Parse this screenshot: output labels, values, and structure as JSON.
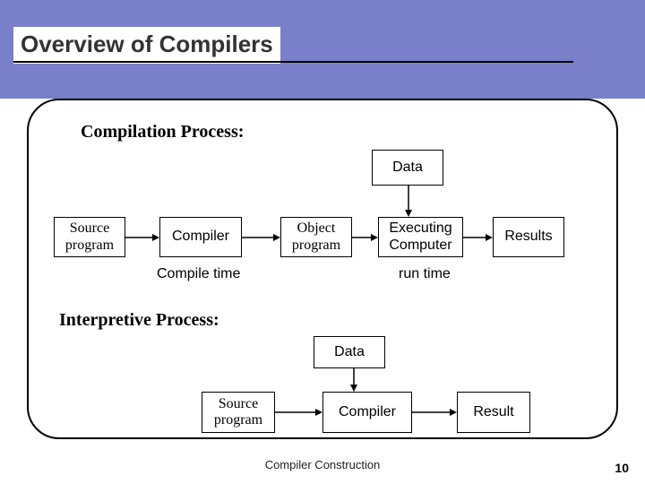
{
  "slide": {
    "title": "Overview of Compilers"
  },
  "section1": {
    "title": "Compilation Process:",
    "data_box": "Data",
    "source": "Source\nprogram",
    "compiler": "Compiler",
    "object": "Object\nprogram",
    "executing": "Executing\nComputer",
    "results": "Results",
    "compile_time": "Compile time",
    "run_time": "run time"
  },
  "section2": {
    "title": "Interpretive Process:",
    "data_box": "Data",
    "source": "Source\nprogram",
    "compiler": "Compiler",
    "result": "Result"
  },
  "footer": {
    "text": "Compiler Construction",
    "page": "10"
  }
}
